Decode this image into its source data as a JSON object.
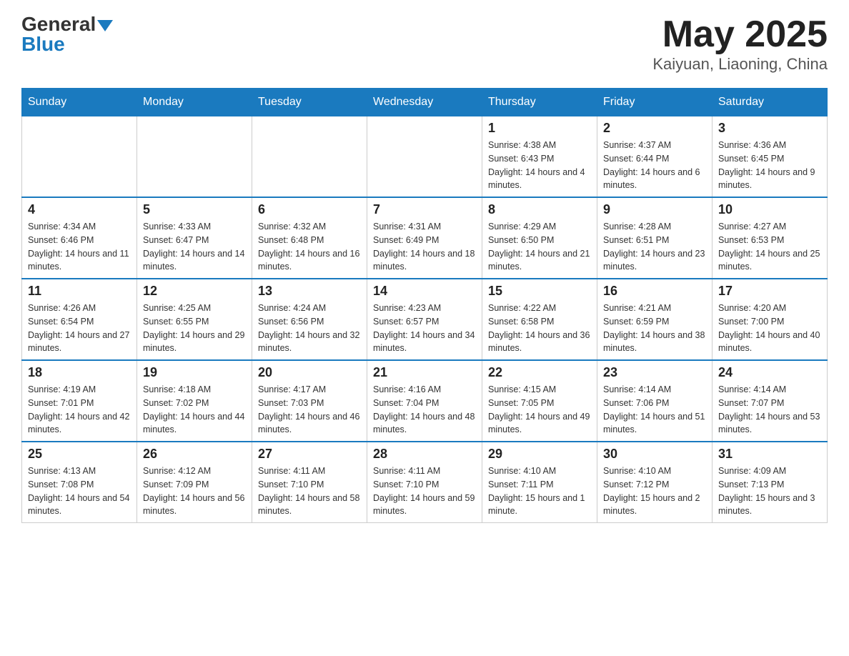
{
  "header": {
    "logo_general": "General",
    "logo_blue": "Blue",
    "month_title": "May 2025",
    "subtitle": "Kaiyuan, Liaoning, China"
  },
  "weekdays": [
    "Sunday",
    "Monday",
    "Tuesday",
    "Wednesday",
    "Thursday",
    "Friday",
    "Saturday"
  ],
  "weeks": [
    [
      {
        "day": "",
        "info": ""
      },
      {
        "day": "",
        "info": ""
      },
      {
        "day": "",
        "info": ""
      },
      {
        "day": "",
        "info": ""
      },
      {
        "day": "1",
        "info": "Sunrise: 4:38 AM\nSunset: 6:43 PM\nDaylight: 14 hours and 4 minutes."
      },
      {
        "day": "2",
        "info": "Sunrise: 4:37 AM\nSunset: 6:44 PM\nDaylight: 14 hours and 6 minutes."
      },
      {
        "day": "3",
        "info": "Sunrise: 4:36 AM\nSunset: 6:45 PM\nDaylight: 14 hours and 9 minutes."
      }
    ],
    [
      {
        "day": "4",
        "info": "Sunrise: 4:34 AM\nSunset: 6:46 PM\nDaylight: 14 hours and 11 minutes."
      },
      {
        "day": "5",
        "info": "Sunrise: 4:33 AM\nSunset: 6:47 PM\nDaylight: 14 hours and 14 minutes."
      },
      {
        "day": "6",
        "info": "Sunrise: 4:32 AM\nSunset: 6:48 PM\nDaylight: 14 hours and 16 minutes."
      },
      {
        "day": "7",
        "info": "Sunrise: 4:31 AM\nSunset: 6:49 PM\nDaylight: 14 hours and 18 minutes."
      },
      {
        "day": "8",
        "info": "Sunrise: 4:29 AM\nSunset: 6:50 PM\nDaylight: 14 hours and 21 minutes."
      },
      {
        "day": "9",
        "info": "Sunrise: 4:28 AM\nSunset: 6:51 PM\nDaylight: 14 hours and 23 minutes."
      },
      {
        "day": "10",
        "info": "Sunrise: 4:27 AM\nSunset: 6:53 PM\nDaylight: 14 hours and 25 minutes."
      }
    ],
    [
      {
        "day": "11",
        "info": "Sunrise: 4:26 AM\nSunset: 6:54 PM\nDaylight: 14 hours and 27 minutes."
      },
      {
        "day": "12",
        "info": "Sunrise: 4:25 AM\nSunset: 6:55 PM\nDaylight: 14 hours and 29 minutes."
      },
      {
        "day": "13",
        "info": "Sunrise: 4:24 AM\nSunset: 6:56 PM\nDaylight: 14 hours and 32 minutes."
      },
      {
        "day": "14",
        "info": "Sunrise: 4:23 AM\nSunset: 6:57 PM\nDaylight: 14 hours and 34 minutes."
      },
      {
        "day": "15",
        "info": "Sunrise: 4:22 AM\nSunset: 6:58 PM\nDaylight: 14 hours and 36 minutes."
      },
      {
        "day": "16",
        "info": "Sunrise: 4:21 AM\nSunset: 6:59 PM\nDaylight: 14 hours and 38 minutes."
      },
      {
        "day": "17",
        "info": "Sunrise: 4:20 AM\nSunset: 7:00 PM\nDaylight: 14 hours and 40 minutes."
      }
    ],
    [
      {
        "day": "18",
        "info": "Sunrise: 4:19 AM\nSunset: 7:01 PM\nDaylight: 14 hours and 42 minutes."
      },
      {
        "day": "19",
        "info": "Sunrise: 4:18 AM\nSunset: 7:02 PM\nDaylight: 14 hours and 44 minutes."
      },
      {
        "day": "20",
        "info": "Sunrise: 4:17 AM\nSunset: 7:03 PM\nDaylight: 14 hours and 46 minutes."
      },
      {
        "day": "21",
        "info": "Sunrise: 4:16 AM\nSunset: 7:04 PM\nDaylight: 14 hours and 48 minutes."
      },
      {
        "day": "22",
        "info": "Sunrise: 4:15 AM\nSunset: 7:05 PM\nDaylight: 14 hours and 49 minutes."
      },
      {
        "day": "23",
        "info": "Sunrise: 4:14 AM\nSunset: 7:06 PM\nDaylight: 14 hours and 51 minutes."
      },
      {
        "day": "24",
        "info": "Sunrise: 4:14 AM\nSunset: 7:07 PM\nDaylight: 14 hours and 53 minutes."
      }
    ],
    [
      {
        "day": "25",
        "info": "Sunrise: 4:13 AM\nSunset: 7:08 PM\nDaylight: 14 hours and 54 minutes."
      },
      {
        "day": "26",
        "info": "Sunrise: 4:12 AM\nSunset: 7:09 PM\nDaylight: 14 hours and 56 minutes."
      },
      {
        "day": "27",
        "info": "Sunrise: 4:11 AM\nSunset: 7:10 PM\nDaylight: 14 hours and 58 minutes."
      },
      {
        "day": "28",
        "info": "Sunrise: 4:11 AM\nSunset: 7:10 PM\nDaylight: 14 hours and 59 minutes."
      },
      {
        "day": "29",
        "info": "Sunrise: 4:10 AM\nSunset: 7:11 PM\nDaylight: 15 hours and 1 minute."
      },
      {
        "day": "30",
        "info": "Sunrise: 4:10 AM\nSunset: 7:12 PM\nDaylight: 15 hours and 2 minutes."
      },
      {
        "day": "31",
        "info": "Sunrise: 4:09 AM\nSunset: 7:13 PM\nDaylight: 15 hours and 3 minutes."
      }
    ]
  ]
}
